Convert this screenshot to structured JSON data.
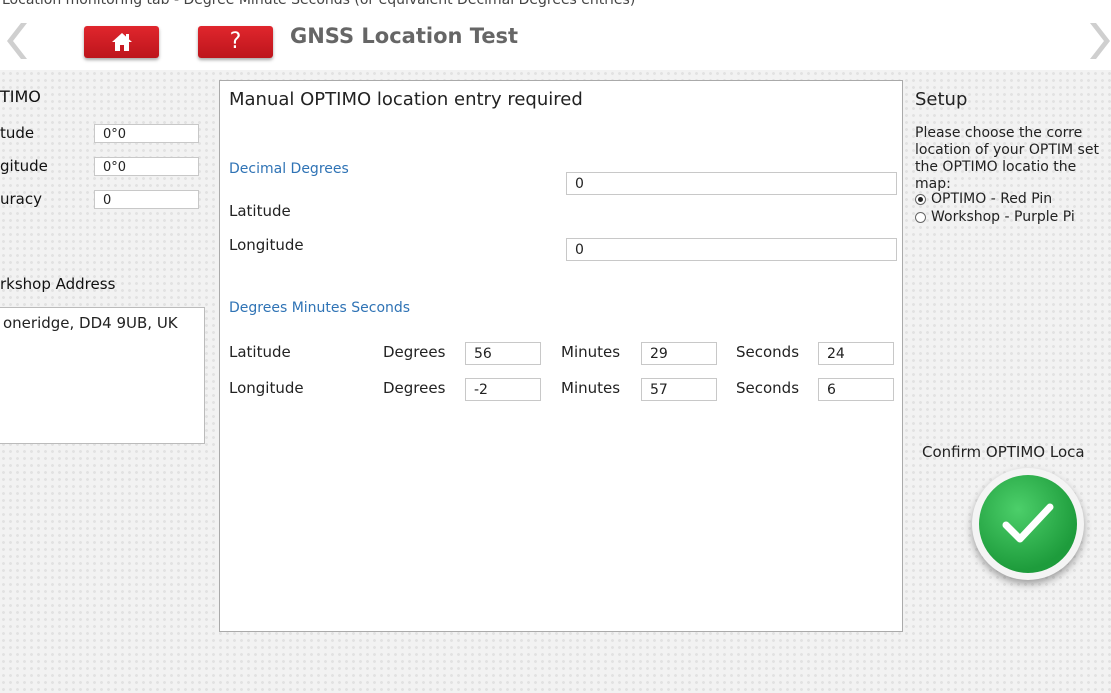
{
  "top_caption": "Location monitoring tab - Degree Minute Seconds (or equivalent Decimal Degrees entries)",
  "header": {
    "title": "GNSS Location Test",
    "help_label": "?"
  },
  "left_panel": {
    "heading": "TIMO",
    "fields": [
      {
        "label": "tude",
        "value": "0°0"
      },
      {
        "label": "gitude",
        "value": "0°0"
      },
      {
        "label": "uracy",
        "value": "0"
      }
    ],
    "workshop_heading": "rkshop Address",
    "workshop_address": "oneridge, DD4 9UB, UK"
  },
  "center_panel": {
    "heading": "Manual OPTIMO location entry required",
    "decimal_title": "Decimal Degrees",
    "decimal_latitude_label": "Latitude",
    "decimal_latitude_value": "0",
    "decimal_longitude_label": "Longitude",
    "decimal_longitude_value": "0",
    "dms_title": "Degrees Minutes Seconds",
    "dms_rows": [
      {
        "label": "Latitude",
        "degrees_label": "Degrees",
        "degrees": "56",
        "minutes_label": "Minutes",
        "minutes": "29",
        "seconds_label": "Seconds",
        "seconds": "24"
      },
      {
        "label": "Longitude",
        "degrees_label": "Degrees",
        "degrees": "-2",
        "minutes_label": "Minutes",
        "minutes": "57",
        "seconds_label": "Seconds",
        "seconds": "6"
      }
    ]
  },
  "right_panel": {
    "heading": "Setup",
    "instructions": "Please choose the corre location of your OPTIM set the OPTIMO locatio the map:",
    "options": [
      {
        "label": "OPTIMO - Red Pin",
        "selected": true
      },
      {
        "label": "Workshop - Purple Pi",
        "selected": false
      }
    ],
    "confirm_label": "Confirm OPTIMO Loca"
  },
  "colors": {
    "accent_red": "#d81f26",
    "section_blue": "#2f73b5",
    "confirm_green": "#2bb04c"
  },
  "icons": {
    "back": "chevron-left-icon",
    "forward": "chevron-right-icon",
    "home": "home-icon",
    "confirm": "checkmark-icon"
  }
}
